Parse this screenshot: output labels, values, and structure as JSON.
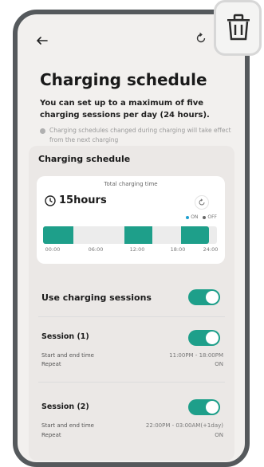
{
  "page": {
    "title": "Charging schedule",
    "subtitle": "You can set up to a maximum of five charging sessions per day (24 hours).",
    "note": "Charging schedules changed during charging will take effect from the next charging"
  },
  "card": {
    "title": "Charging schedule",
    "total_label": "Total charging time",
    "hours": "15hours",
    "legend_on": "ON",
    "legend_off": "OFF",
    "tick_labels": [
      "00:00",
      "06:00",
      "12:00",
      "18:00",
      "24:00"
    ],
    "colors": {
      "on": "#1e9f8a",
      "off": "#ececec",
      "legend_on": "#1e9fd0"
    }
  },
  "use_sessions": {
    "label": "Use charging sessions",
    "enabled": true
  },
  "sessions": [
    {
      "title": "Session (1)",
      "start_end_label": "Start and end time",
      "start_end_value": "11:00PM - 18:00PM",
      "repeat_label": "Repeat",
      "repeat_value": "ON",
      "enabled": true
    },
    {
      "title": "Session (2)",
      "start_end_label": "Start and end time",
      "start_end_value": "22:00PM - 03:00AM(+1day)",
      "repeat_label": "Repeat",
      "repeat_value": "ON",
      "enabled": true
    }
  ],
  "icons": {
    "back": "back-arrow-icon",
    "refresh": "refresh-icon",
    "delete": "trash-icon",
    "clock": "clock-icon",
    "info": "info-dot-icon"
  }
}
